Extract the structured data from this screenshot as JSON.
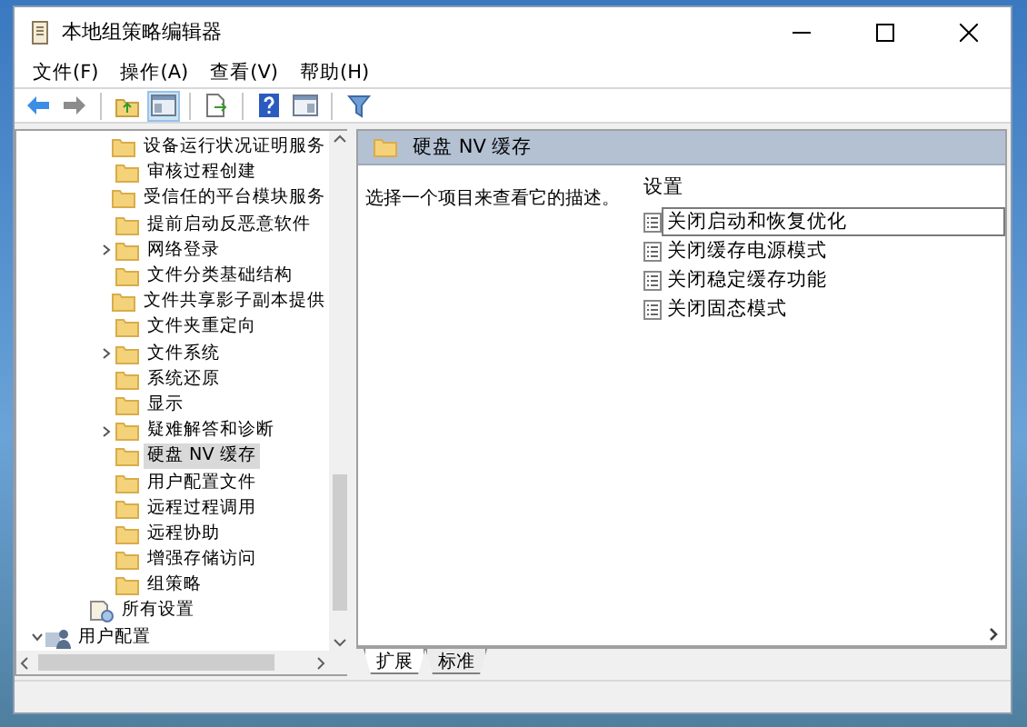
{
  "window": {
    "title": "本地组策略编辑器"
  },
  "menu": [
    "文件(F)",
    "操作(A)",
    "查看(V)",
    "帮助(H)"
  ],
  "toolbar": [
    {
      "kind": "back",
      "disabled": false
    },
    {
      "kind": "forward",
      "disabled": true
    },
    {
      "kind": "sep"
    },
    {
      "kind": "up",
      "selected": false
    },
    {
      "kind": "tree",
      "selected": true
    },
    {
      "kind": "sep"
    },
    {
      "kind": "export",
      "selected": false
    },
    {
      "kind": "sep"
    },
    {
      "kind": "help",
      "selected": false
    },
    {
      "kind": "properties",
      "selected": false
    },
    {
      "kind": "sep"
    },
    {
      "kind": "filter",
      "selected": false
    }
  ],
  "tree": {
    "folders": [
      {
        "label": "设备运行状况证明服务",
        "expandable": false,
        "selected": false
      },
      {
        "label": "审核过程创建",
        "expandable": false,
        "selected": false
      },
      {
        "label": "受信任的平台模块服务",
        "expandable": false,
        "selected": false
      },
      {
        "label": "提前启动反恶意软件",
        "expandable": false,
        "selected": false
      },
      {
        "label": "网络登录",
        "expandable": true,
        "selected": false
      },
      {
        "label": "文件分类基础结构",
        "expandable": false,
        "selected": false
      },
      {
        "label": "文件共享影子副本提供",
        "expandable": false,
        "selected": false
      },
      {
        "label": "文件夹重定向",
        "expandable": false,
        "selected": false
      },
      {
        "label": "文件系统",
        "expandable": true,
        "selected": false
      },
      {
        "label": "系统还原",
        "expandable": false,
        "selected": false
      },
      {
        "label": "显示",
        "expandable": false,
        "selected": false
      },
      {
        "label": "疑难解答和诊断",
        "expandable": true,
        "selected": false
      },
      {
        "label": "硬盘 NV 缓存",
        "expandable": false,
        "selected": true
      },
      {
        "label": "用户配置文件",
        "expandable": false,
        "selected": false
      },
      {
        "label": "远程过程调用",
        "expandable": false,
        "selected": false
      },
      {
        "label": "远程协助",
        "expandable": false,
        "selected": false
      },
      {
        "label": "增强存储访问",
        "expandable": false,
        "selected": false
      },
      {
        "label": "组策略",
        "expandable": false,
        "selected": false
      }
    ],
    "all_settings": {
      "label": "所有设置"
    },
    "user_config": {
      "label": "用户配置",
      "expanded": true
    }
  },
  "details": {
    "header": "硬盘 NV 缓存",
    "description": "选择一个项目来查看它的描述。",
    "column": "设置",
    "settings": [
      {
        "label": "关闭启动和恢复优化",
        "focused": true
      },
      {
        "label": "关闭缓存电源模式",
        "focused": false
      },
      {
        "label": "关闭稳定缓存功能",
        "focused": false
      },
      {
        "label": "关闭固态模式",
        "focused": false
      }
    ]
  },
  "tabs": [
    {
      "label": "扩展",
      "selected": true
    },
    {
      "label": "标准",
      "selected": false
    }
  ]
}
